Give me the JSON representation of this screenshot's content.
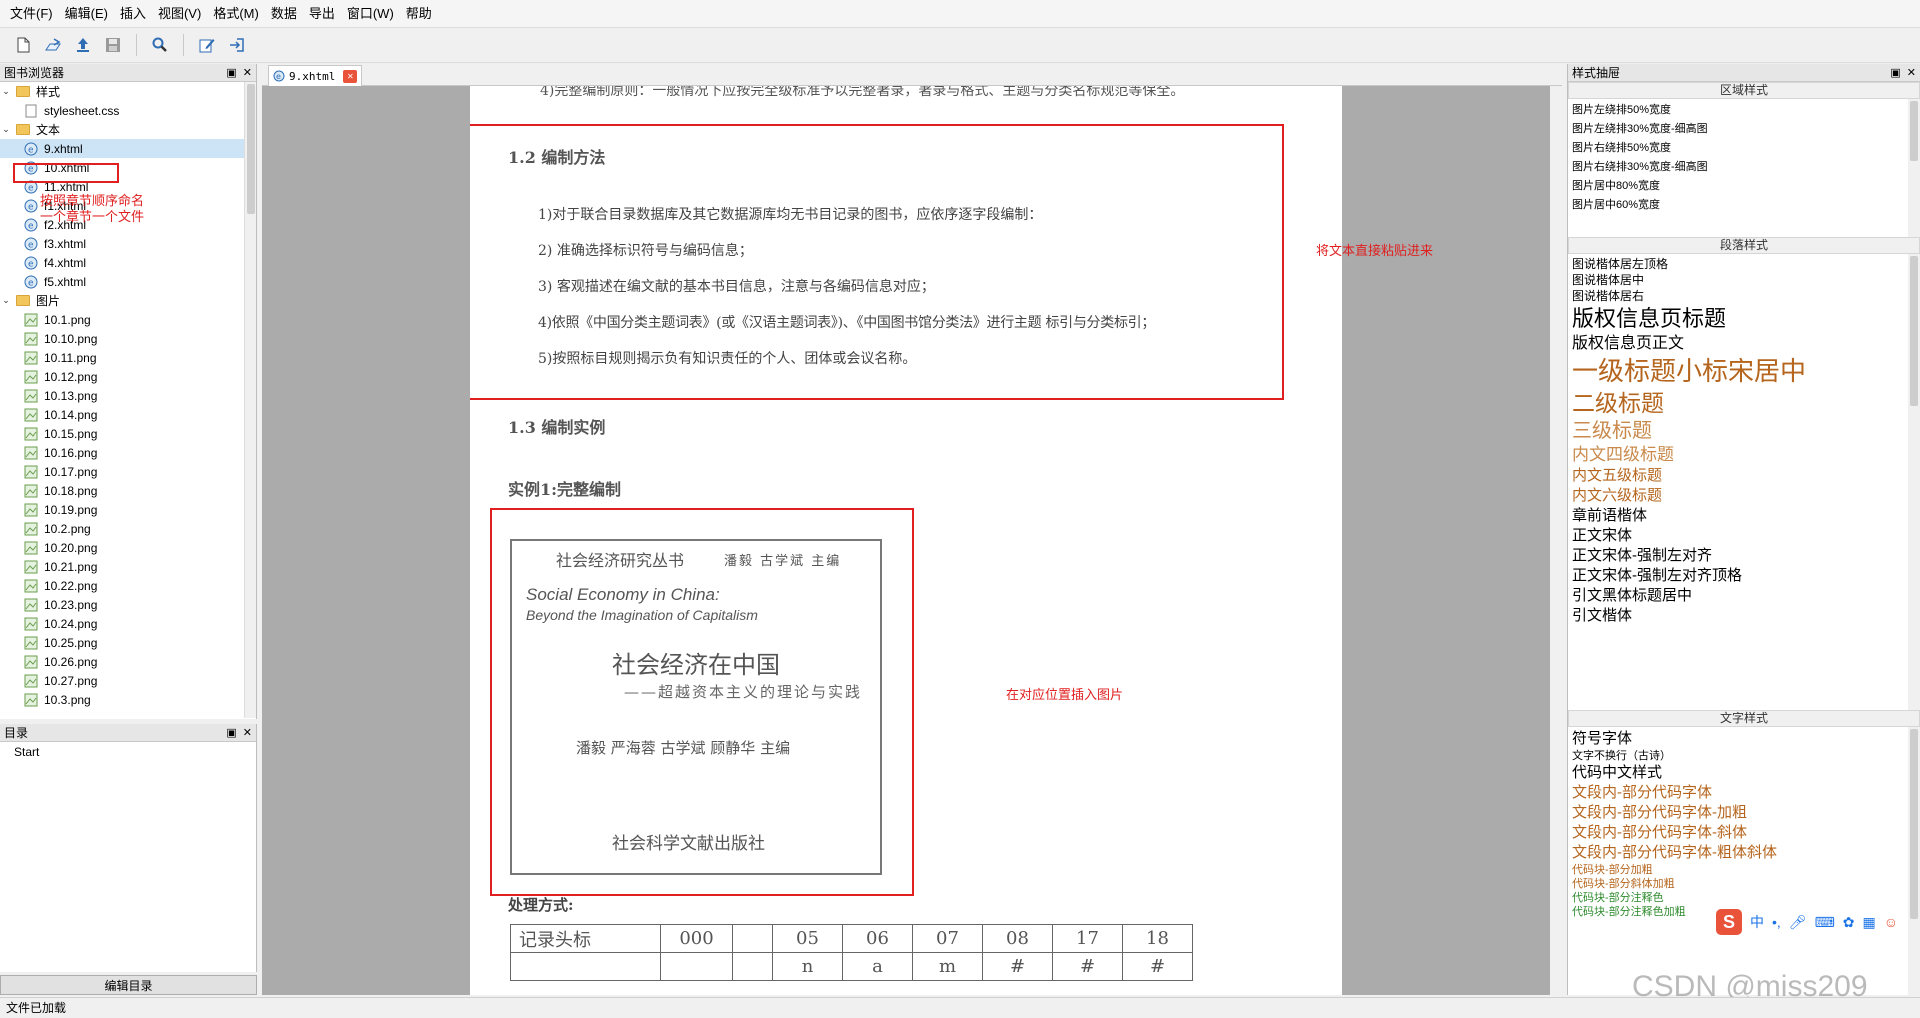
{
  "menubar": {
    "items": [
      "文件(F)",
      "编辑(E)",
      "插入",
      "视图(V)",
      "格式(M)",
      "数据",
      "导出",
      "窗口(W)",
      "帮助"
    ]
  },
  "toolbar": {
    "buttons": [
      "new-file-icon",
      "open-icon",
      "upload-icon",
      "save-icon",
      "search-icon",
      "edit-icon",
      "import-icon"
    ]
  },
  "book_browser": {
    "title": "图书浏览器",
    "tree": [
      {
        "type": "folder",
        "label": "样式",
        "level": 0
      },
      {
        "type": "css",
        "label": "stylesheet.css",
        "level": 1
      },
      {
        "type": "folder",
        "label": "文本",
        "level": 0
      },
      {
        "type": "xhtml",
        "label": "9.xhtml",
        "level": 1,
        "selected": true
      },
      {
        "type": "xhtml",
        "label": "10.xhtml",
        "level": 1
      },
      {
        "type": "xhtml",
        "label": "11.xhtml",
        "level": 1
      },
      {
        "type": "xhtml",
        "label": "f1.xhtml",
        "level": 1
      },
      {
        "type": "xhtml",
        "label": "f2.xhtml",
        "level": 1
      },
      {
        "type": "xhtml",
        "label": "f3.xhtml",
        "level": 1
      },
      {
        "type": "xhtml",
        "label": "f4.xhtml",
        "level": 1
      },
      {
        "type": "xhtml",
        "label": "f5.xhtml",
        "level": 1
      },
      {
        "type": "folder",
        "label": "图片",
        "level": 0
      },
      {
        "type": "png",
        "label": "10.1.png",
        "level": 1
      },
      {
        "type": "png",
        "label": "10.10.png",
        "level": 1
      },
      {
        "type": "png",
        "label": "10.11.png",
        "level": 1
      },
      {
        "type": "png",
        "label": "10.12.png",
        "level": 1
      },
      {
        "type": "png",
        "label": "10.13.png",
        "level": 1
      },
      {
        "type": "png",
        "label": "10.14.png",
        "level": 1
      },
      {
        "type": "png",
        "label": "10.15.png",
        "level": 1
      },
      {
        "type": "png",
        "label": "10.16.png",
        "level": 1
      },
      {
        "type": "png",
        "label": "10.17.png",
        "level": 1
      },
      {
        "type": "png",
        "label": "10.18.png",
        "level": 1
      },
      {
        "type": "png",
        "label": "10.19.png",
        "level": 1
      },
      {
        "type": "png",
        "label": "10.2.png",
        "level": 1
      },
      {
        "type": "png",
        "label": "10.20.png",
        "level": 1
      },
      {
        "type": "png",
        "label": "10.21.png",
        "level": 1
      },
      {
        "type": "png",
        "label": "10.22.png",
        "level": 1
      },
      {
        "type": "png",
        "label": "10.23.png",
        "level": 1
      },
      {
        "type": "png",
        "label": "10.24.png",
        "level": 1
      },
      {
        "type": "png",
        "label": "10.25.png",
        "level": 1
      },
      {
        "type": "png",
        "label": "10.26.png",
        "level": 1
      },
      {
        "type": "png",
        "label": "10.27.png",
        "level": 1
      },
      {
        "type": "png",
        "label": "10.3.png",
        "level": 1
      }
    ],
    "annotation_line1": "按照章节顺序命名",
    "annotation_line2": "一个章节一个文件"
  },
  "toc": {
    "title": "目录",
    "items": [
      "Start"
    ],
    "edit_button": "编辑目录"
  },
  "status": "文件已加载",
  "editor": {
    "tab_label": "9.xhtml",
    "top_text": "4)完整编制原则：一般情况下应按完全级标准予以完整著录，著录与格式、主题与分类名标规范等保全。",
    "heading_12": "1.2 编制方法",
    "paras": [
      "1)对于联合目录数据库及其它数据源库均无书目记录的图书，应依序逐字段编制：",
      "2) 准确选择标识符号与编码信息；",
      "3) 客观描述在编文献的基本书目信息，注意与各编码信息对应；",
      "4)依照《中国分类主题词表》(或《汉语主题词表》)、《中国图书馆分类法》进行主题 标引与分类标引；",
      "5)按照标目规则揭示负有知识责任的个人、团体或会议名称。"
    ],
    "note_paste": "将文本直接粘贴进来",
    "heading_13": "1.3 编制实例",
    "heading_ex1": "实例1:完整编制",
    "note_image": "在对应位置插入图片",
    "cover": {
      "series": "社会经济研究丛书",
      "series_editors": "潘毅  古学斌  主编",
      "en_title1": "Social Economy in China:",
      "en_title2": "Beyond the Imagination of Capitalism",
      "cn_title": "社会经济在中国",
      "cn_subtitle": "——超越资本主义的理论与实践",
      "authors": "潘毅  严海蓉  古学斌  顾静华  主编",
      "publisher": "社会科学文献出版社"
    },
    "process_label": "处理方式:",
    "record_table": {
      "row1": [
        "记录头标",
        "000",
        "",
        "05",
        "06",
        "07",
        "08",
        "17",
        "18"
      ],
      "row2": [
        "",
        "",
        "",
        "n",
        "a",
        "m",
        "#",
        "#",
        "#"
      ]
    }
  },
  "styles_panel": {
    "title": "样式抽屉",
    "block_header": "区域样式",
    "block_items": [
      "图片左绕排50%宽度",
      "图片左绕排30%宽度-细高图",
      "图片右绕排50%宽度",
      "图片右绕排30%宽度-细高图",
      "图片居中80%宽度",
      "图片居中60%宽度"
    ],
    "para_header": "段落样式",
    "para_items": [
      {
        "label": "图说楷体居左顶格",
        "size": 12,
        "color": "#000000"
      },
      {
        "label": "图说楷体居中",
        "size": 12,
        "color": "#000000"
      },
      {
        "label": "图说楷体居右",
        "size": 12,
        "color": "#000000"
      },
      {
        "label": "版权信息页标题",
        "size": 22,
        "color": "#000000"
      },
      {
        "label": "版权信息页正文",
        "size": 16,
        "color": "#000000"
      },
      {
        "label": "一级标题小标宋居中",
        "size": 26,
        "color": "#b5651d"
      },
      {
        "label": "二级标题",
        "size": 23,
        "color": "#b5651d"
      },
      {
        "label": "三级标题",
        "size": 20,
        "color": "#c98a4b"
      },
      {
        "label": "内文四级标题",
        "size": 17,
        "color": "#c98a4b"
      },
      {
        "label": "内文五级标题",
        "size": 15,
        "color": "#b5651d"
      },
      {
        "label": "内文六级标题",
        "size": 15,
        "color": "#b5651d"
      },
      {
        "label": "章前语楷体",
        "size": 15,
        "color": "#000000"
      },
      {
        "label": "正文宋体",
        "size": 15,
        "color": "#000000"
      },
      {
        "label": "正文宋体-强制左对齐",
        "size": 15,
        "color": "#000000"
      },
      {
        "label": "正文宋体-强制左对齐顶格",
        "size": 15,
        "color": "#000000"
      },
      {
        "label": "引文黑体标题居中",
        "size": 15,
        "color": "#000000"
      },
      {
        "label": "引文楷体",
        "size": 15,
        "color": "#000000"
      }
    ],
    "text_header": "文字样式",
    "text_items": [
      {
        "label": "符号字体",
        "size": 15,
        "color": "#000000"
      },
      {
        "label": "文字不换行（古诗）",
        "size": 11,
        "color": "#000000"
      },
      {
        "label": "代码中文样式",
        "size": 15,
        "color": "#000000"
      },
      {
        "label": "文段内-部分代码字体",
        "size": 15,
        "color": "#b5651d"
      },
      {
        "label": "文段内-部分代码字体-加粗",
        "size": 15,
        "color": "#b5651d"
      },
      {
        "label": "文段内-部分代码字体-斜体",
        "size": 15,
        "color": "#b5651d"
      },
      {
        "label": "文段内-部分代码字体-粗体斜体",
        "size": 15,
        "color": "#b5651d"
      },
      {
        "label": "代码块-部分加粗",
        "size": 11,
        "color": "#b5651d"
      },
      {
        "label": "代码块-部分斜体加粗",
        "size": 11,
        "color": "#b5651d"
      },
      {
        "label": "代码块-部分注释色",
        "size": 11,
        "color": "#2e8b2e"
      },
      {
        "label": "代码块-部分注释色加粗",
        "size": 11,
        "color": "#2e8b2e"
      }
    ]
  },
  "ime": {
    "logo": "S",
    "items": [
      "中",
      "•,",
      "mic-icon",
      "keyboard-icon",
      "skin-icon",
      "grid-icon",
      "face-icon"
    ]
  },
  "watermark": "CSDN @miss209",
  "colors": {
    "annotation_red": "#e02020",
    "accent_brown": "#b5651d",
    "code_green": "#2e8b2e"
  }
}
